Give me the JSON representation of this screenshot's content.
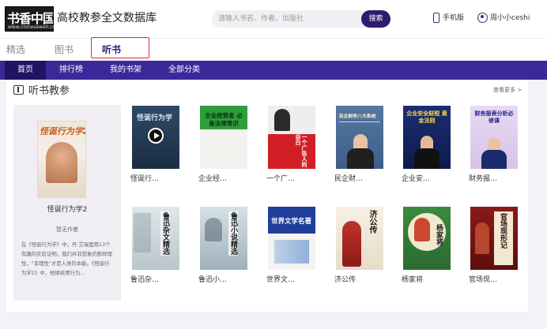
{
  "header": {
    "logo_text": "书香中国",
    "logo_url": "www.chinesewell.cn",
    "site_title": "高校教参全文数据库",
    "search_placeholder": "请输入书名、作者、出版社",
    "search_label": "搜索",
    "mobile_label": "手机版",
    "user_name": "周小小ceshi"
  },
  "categories": [
    {
      "label": "精选",
      "active": false
    },
    {
      "label": "图书",
      "active": false
    },
    {
      "label": "听书",
      "active": true
    }
  ],
  "nav": [
    {
      "label": "首页",
      "active": true
    },
    {
      "label": "排行榜",
      "active": false
    },
    {
      "label": "我的书架",
      "active": false
    },
    {
      "label": "全部分类",
      "active": false
    }
  ],
  "section": {
    "title": "听书教参",
    "more": "查看更多 >",
    "featured": {
      "cover_text": "怪诞行为学2",
      "title": "怪诞行为学2",
      "author": "暂无作者",
      "description": "在《怪诞行为学》中，丹·艾瑞里用13个有趣的实验证明，我们并非想象的那样理性，\"非理性\"才是人类的本能。《怪诞行为学2》中，他继续用行为..."
    },
    "books": [
      {
        "label": "怪诞行…",
        "cover_text": "怪诞行为学"
      },
      {
        "label": "企业经…",
        "cover_text": "企业经营者 必备法律常识"
      },
      {
        "label": "一个广…",
        "cover_text": "一个广告人的自白"
      },
      {
        "label": "民企财…",
        "cover_text": "民企财务八大系统"
      },
      {
        "label": "企业安…",
        "cover_text": "企业安全财税 黄金法则"
      },
      {
        "label": "财务报…",
        "cover_text": "财务报表分析必修课"
      },
      {
        "label": "鲁迅杂…",
        "cover_text": "鲁迅杂文精选"
      },
      {
        "label": "鲁迅小…",
        "cover_text": "鲁迅小说精选"
      },
      {
        "label": "世界文…",
        "cover_text": "世界文学名著"
      },
      {
        "label": "济公传",
        "cover_text": "济公传"
      },
      {
        "label": "杨家将",
        "cover_text": "杨家将"
      },
      {
        "label": "官场现…",
        "cover_text": "官场现形记"
      }
    ]
  },
  "colors": {
    "brand": "#2d1b6e",
    "nav_bg": "#3a2a99",
    "highlight_border": "#e0303a"
  }
}
